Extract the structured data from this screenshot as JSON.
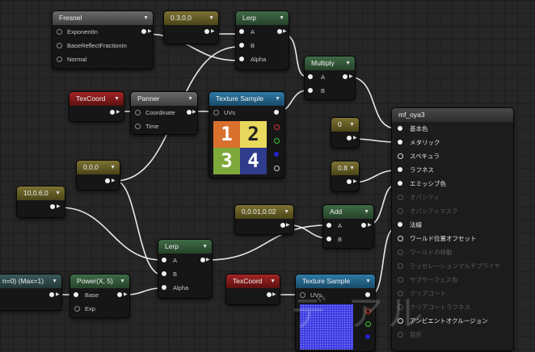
{
  "nodes": {
    "fresnel": {
      "title": "Fresnel",
      "pins": [
        "ExponentIn",
        "BaseReflectFractionIn",
        "Normal"
      ]
    },
    "const_030": {
      "title": "0.3,0,0"
    },
    "lerp_top": {
      "title": "Lerp",
      "pins": [
        "A",
        "B",
        "Alpha"
      ]
    },
    "multiply": {
      "title": "Multiply",
      "pins": [
        "A",
        "B"
      ]
    },
    "texcoord_top": {
      "title": "TexCoord"
    },
    "panner": {
      "title": "Panner",
      "pins": [
        "Coordinate",
        "Time"
      ]
    },
    "texsample_top": {
      "title": "Texture Sample",
      "pins": [
        "UVs"
      ],
      "tiles": [
        "1",
        "2",
        "3",
        "4"
      ]
    },
    "const_000": {
      "title": "0,0,0"
    },
    "const_1006": {
      "title": "10,0.6,0"
    },
    "const_0": {
      "title": "0"
    },
    "const_08": {
      "title": "0.8"
    },
    "const_small": {
      "title": "0,0.01,0.02"
    },
    "add": {
      "title": "Add",
      "pins": [
        "A",
        "B"
      ]
    },
    "lerp_bottom": {
      "title": "Lerp",
      "pins": [
        "A",
        "B",
        "Alpha"
      ]
    },
    "clamp_partial": {
      "title": "n=0) (Max=1)"
    },
    "power": {
      "title": "Power(X, 5)",
      "pins": [
        "Base",
        "Exp"
      ]
    },
    "texcoord_bottom": {
      "title": "TexCoord"
    },
    "texsample_bottom": {
      "title": "Texture Sample",
      "pins": [
        "UVs"
      ]
    },
    "material": {
      "title": "mf_oya3",
      "pins": [
        "基本色",
        "メタリック",
        "スペキュラ",
        "ラフネス",
        "エミッシブ色",
        "オパシティ",
        "オパシティマスク",
        "法線",
        "ワールド位置オフセット",
        "ワールドの移動",
        "テッセレーションマルチプライヤ",
        "サブサーフェス色",
        "クリアコート",
        "クリアコートラフネス",
        "アンビエントオクルージョン",
        "屈折"
      ]
    }
  },
  "watermark": "デ アル"
}
